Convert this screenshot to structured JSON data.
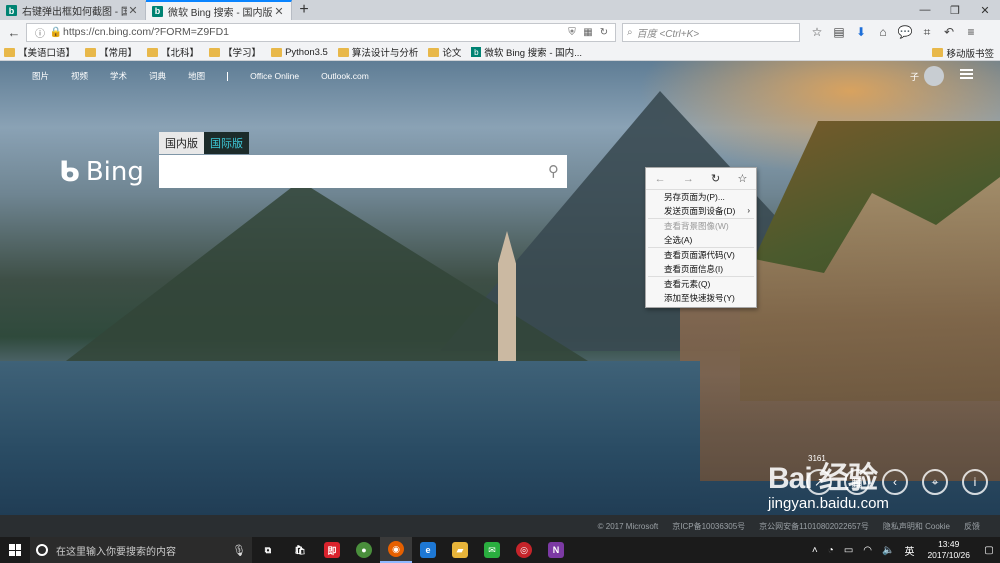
{
  "browser": {
    "tabs": [
      {
        "title": "右键弹出框如何截图 - 国内...",
        "active": false
      },
      {
        "title": "微软 Bing 搜索 - 国内版",
        "active": true
      }
    ],
    "url": "https://cn.bing.com/?FORM=Z9FD1",
    "search_placeholder": "百度 <Ctrl+K>",
    "bookmarks": [
      {
        "label": "【美语口语】",
        "type": "folder"
      },
      {
        "label": "【常用】",
        "type": "folder"
      },
      {
        "label": "【北科】",
        "type": "folder"
      },
      {
        "label": "【学习】",
        "type": "folder"
      },
      {
        "label": "Python3.5",
        "type": "folder"
      },
      {
        "label": "算法设计与分析",
        "type": "folder"
      },
      {
        "label": "论文",
        "type": "folder"
      },
      {
        "label": "微软 Bing 搜索 - 国内...",
        "type": "page"
      }
    ],
    "mobile_bookmarks": "移动版书签",
    "favicon_letter": "b"
  },
  "bing": {
    "nav": [
      "图片",
      "视频",
      "学术",
      "词典",
      "地图"
    ],
    "nav_extra": [
      "Office Online",
      "Outlook.com"
    ],
    "user_initial": "子",
    "logo_text": "Bing",
    "market_tabs": {
      "domestic": "国内版",
      "international": "国际版"
    },
    "footer": [
      "© 2017 Microsoft",
      "京ICP备10036305号",
      "京公网安备11010802022657号",
      "隐私声明和 Cookie",
      "反馈"
    ]
  },
  "context_menu": {
    "nav_icons": {
      "back": "←",
      "forward": "→",
      "reload": "↻",
      "bookmark": "☆"
    },
    "items": [
      {
        "label": "另存页面为(P)...",
        "disabled": false
      },
      {
        "label": "发送页面到设备(D)",
        "disabled": false,
        "submenu": true
      },
      {
        "label": "查看背景图像(W)",
        "disabled": true
      },
      {
        "label": "全选(A)",
        "disabled": false
      },
      {
        "label": "查看页面源代码(V)",
        "disabled": false
      },
      {
        "label": "查看页面信息(I)",
        "disabled": false
      },
      {
        "label": "查看元素(Q)",
        "disabled": false
      },
      {
        "label": "添加至快速拨号(Y)",
        "disabled": false
      }
    ]
  },
  "watermark": {
    "brand": "Bai 经验",
    "site": "jingyan.baidu.com",
    "count": "3161"
  },
  "taskbar": {
    "search_placeholder": "在这里输入你要搜索的内容",
    "apps": [
      {
        "name": "task-view",
        "label": "⧉",
        "color": "#1b1b1b"
      },
      {
        "name": "store",
        "label": "🛍",
        "color": "#1b1b1b"
      },
      {
        "name": "app-red",
        "label": "即",
        "color": "#d9232d"
      },
      {
        "name": "chrome",
        "label": "●",
        "color": "#4a8f3c"
      },
      {
        "name": "firefox",
        "label": "◉",
        "color": "#e66000"
      },
      {
        "name": "edge",
        "label": "e",
        "color": "#1e78d4"
      },
      {
        "name": "explorer",
        "label": "▰",
        "color": "#e7b43a"
      },
      {
        "name": "wechat",
        "label": "✉",
        "color": "#2aae3f"
      },
      {
        "name": "netease",
        "label": "◎",
        "color": "#c6242a"
      },
      {
        "name": "onenote",
        "label": "N",
        "color": "#7c3aa4"
      }
    ],
    "ime": "英",
    "time": "13:49",
    "date": "2017/10/26"
  }
}
